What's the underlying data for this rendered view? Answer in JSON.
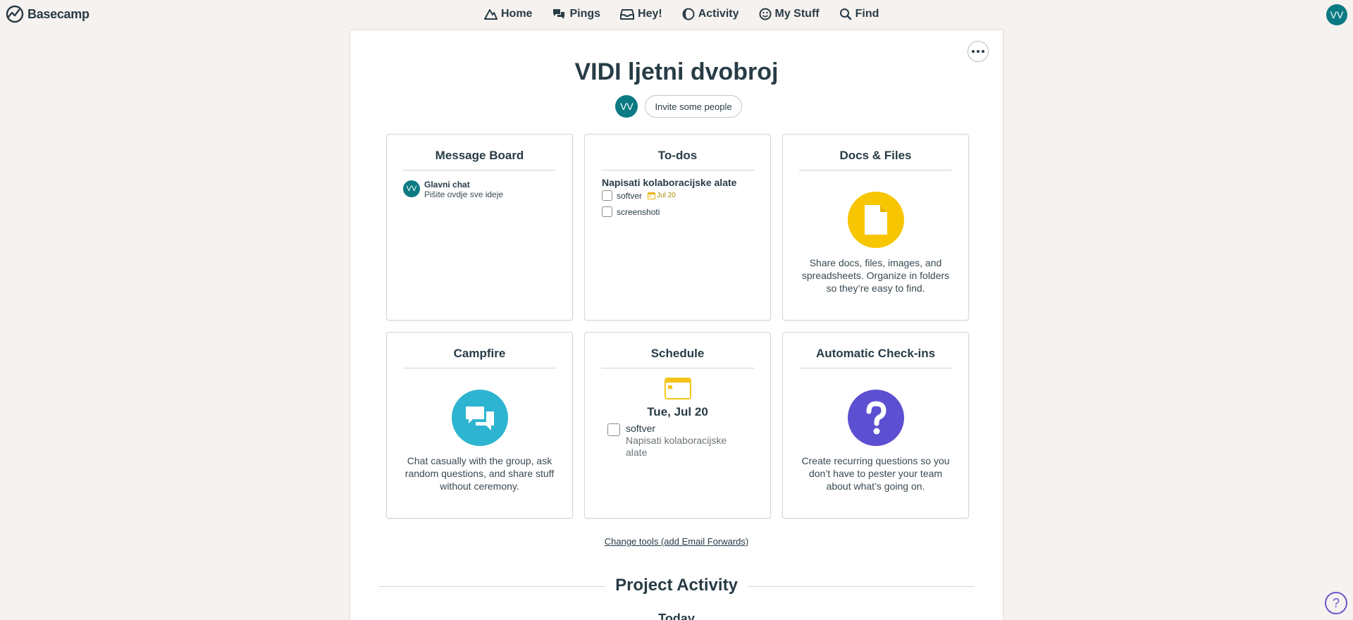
{
  "app": {
    "name": "Basecamp"
  },
  "nav": {
    "items": [
      {
        "label": "Home",
        "icon": "mountain-icon"
      },
      {
        "label": "Pings",
        "icon": "chat-bubbles-icon"
      },
      {
        "label": "Hey!",
        "icon": "inbox-icon"
      },
      {
        "label": "Activity",
        "icon": "moon-icon"
      },
      {
        "label": "My Stuff",
        "icon": "smiley-icon"
      },
      {
        "label": "Find",
        "icon": "search-icon"
      }
    ]
  },
  "user": {
    "initials": "VV"
  },
  "project": {
    "title": "VIDI ljetni dvobroj",
    "member_initials": "VV",
    "invite_label": "Invite some people"
  },
  "tools": {
    "message_board": {
      "title": "Message Board",
      "messages": [
        {
          "author_initials": "VV",
          "title": "Glavni chat",
          "excerpt": "Pišite ovdje sve ideje"
        }
      ]
    },
    "todos": {
      "title": "To-dos",
      "list_title": "Napisati kolaboracijske alate",
      "items": [
        {
          "label": "softver",
          "due": "Jul 20"
        },
        {
          "label": "screenshoti"
        }
      ]
    },
    "docs": {
      "title": "Docs & Files",
      "blurb": "Share docs, files, images, and spreadsheets. Organize in folders so they’re easy to find.",
      "icon_color": "#f7c600"
    },
    "campfire": {
      "title": "Campfire",
      "blurb": "Chat casually with the group, ask random questions, and share stuff without ceremony.",
      "icon_color": "#2db4d0"
    },
    "schedule": {
      "title": "Schedule",
      "date": "Tue, Jul 20",
      "event_title": "softver",
      "event_sub": "Napisati kolaboracijske alate"
    },
    "checkins": {
      "title": "Automatic Check-ins",
      "blurb": "Create recurring questions so you don’t have to pester your team about what’s going on.",
      "icon_color": "#5d4fd1"
    }
  },
  "change_tools_label": "Change tools (add Email Forwards)",
  "activity": {
    "title": "Project Activity",
    "day_label": "Today"
  },
  "colors": {
    "background": "#f6f2ef",
    "avatar": "#0b7a82",
    "text": "#283c46"
  }
}
